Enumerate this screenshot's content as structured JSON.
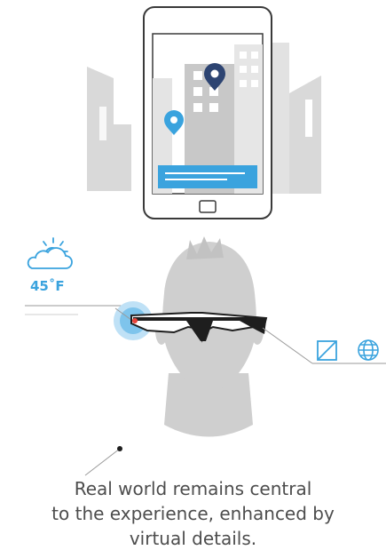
{
  "weather": {
    "icon": "cloud-sun-icon",
    "temperature": "45˚F"
  },
  "caption": {
    "line1": "Real world remains central",
    "line2": "to the experience, enhanced by",
    "line3": "virtual details."
  },
  "colors": {
    "accent_blue": "#3aa3de",
    "map_pin_dark": "#2d4472",
    "building_gray": "#d6d6d6",
    "head_gray": "#cfcfcf",
    "outline": "#3a3a3a",
    "text": "#4d4d4d",
    "hud_red": "#e8443a"
  },
  "icons": {
    "phone_pins": [
      "map-pin-blue-icon",
      "map-pin-dark-icon"
    ],
    "hud_icons": [
      "image-frame-icon",
      "globe-icon"
    ]
  }
}
